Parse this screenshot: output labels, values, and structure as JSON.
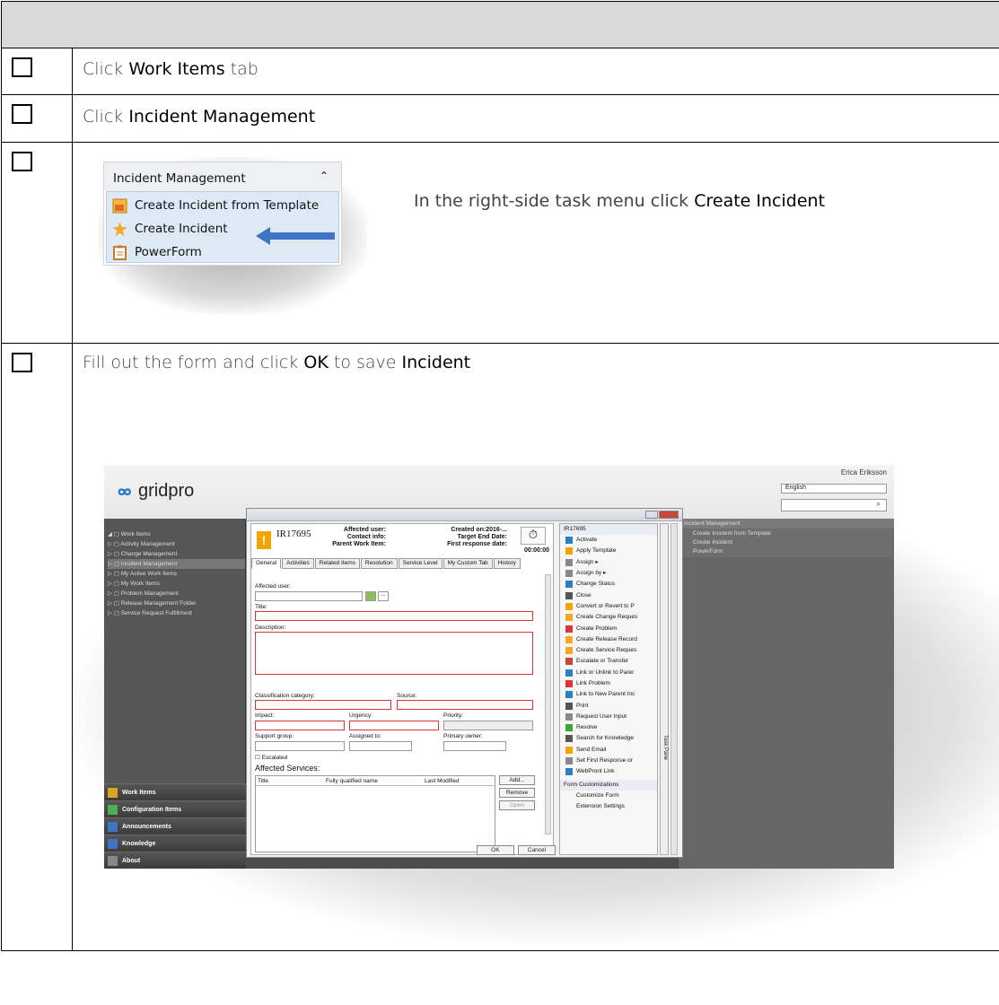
{
  "steps": [
    {
      "pre": "Click ",
      "bold": "Work Items",
      "post": " tab"
    },
    {
      "pre": "Click ",
      "bold": "Incident Management",
      "post": ""
    },
    {
      "pre": "In the right-side task menu click ",
      "bold": "Create Incident",
      "post": ""
    },
    {
      "pre": "Fill out the form and click ",
      "bold": "OK",
      "mid": " to save ",
      "bold2": "Incident"
    }
  ],
  "task_menu": {
    "title": "Incident Management",
    "items": [
      "Create Incident from Template",
      "Create Incident",
      "PowerForm"
    ]
  },
  "app": {
    "brand": "gridpro",
    "user": "Erica Eriksson",
    "language": "English",
    "nav_tree": [
      "Work Items",
      "Activity Management",
      "Change Management",
      "Incident Management",
      "My Active Work Items",
      "My Work Items",
      "Problem Management",
      "Release Management Folder",
      "Service Request Fulfillment"
    ],
    "workspaces": [
      "Work Items",
      "Configuration Items",
      "Announcements",
      "Knowledge",
      "About"
    ],
    "right_title": "Incident Management",
    "right_items": [
      "Create Incident from Template",
      "Create Incident",
      "PowerForm"
    ],
    "form": {
      "id": "IR17695",
      "affected_user_h": "Affected user:",
      "contact_h": "Contact info:",
      "parent_h": "Parent Work Item:",
      "created_h": "Created on:2016-...",
      "target_h": "Target End Date:",
      "first_h": "First response date:",
      "timer": "00:00:00",
      "tabs": [
        "General",
        "Activities",
        "Related Items",
        "Resolution",
        "Service Level",
        "My Custom Tab",
        "History"
      ],
      "lbl_affected": "Affected user:",
      "lbl_title": "Title:",
      "lbl_desc": "Description:",
      "lbl_class": "Classification category:",
      "lbl_source": "Source:",
      "lbl_impact": "Impact:",
      "lbl_urgency": "Urgency:",
      "lbl_priority": "Priority:",
      "lbl_support": "Support group:",
      "lbl_assigned": "Assigned to:",
      "lbl_owner": "Primary owner:",
      "lbl_escalated": "Escalated",
      "lbl_services": "Affected Services:",
      "cols": [
        "Title",
        "Fully qualified name",
        "Last Modified"
      ],
      "btn_add": "Add...",
      "btn_remove": "Remove",
      "btn_open": "Open",
      "btn_ok": "OK",
      "btn_cancel": "Cancel"
    },
    "tasks_title": "IR17695",
    "tasks": [
      "Activate",
      "Apply Template",
      "Assign ▸",
      "Assign by ▸",
      "Change Status",
      "Close",
      "Convert or Revert to P",
      "Create Change Reques",
      "Create Problem",
      "Create Release Record",
      "Create Service Reques",
      "Escalate or Transfer",
      "Link or Unlink to Parer",
      "Link Problem",
      "Link to New Parent Inc",
      "Print",
      "Request User Input",
      "Resolve",
      "Search for Knowledge",
      "Send Email",
      "Set First Response or",
      "WebPront Link"
    ],
    "custom_title": "Form Customizations",
    "custom_items": [
      "Customize Form",
      "Extension Settings"
    ],
    "task_pane": "Task Pane"
  },
  "colors": {
    "arrow": "#3d74c4",
    "header_bg": "#d9d9d9",
    "panel_blue": "#ddeaf6"
  }
}
